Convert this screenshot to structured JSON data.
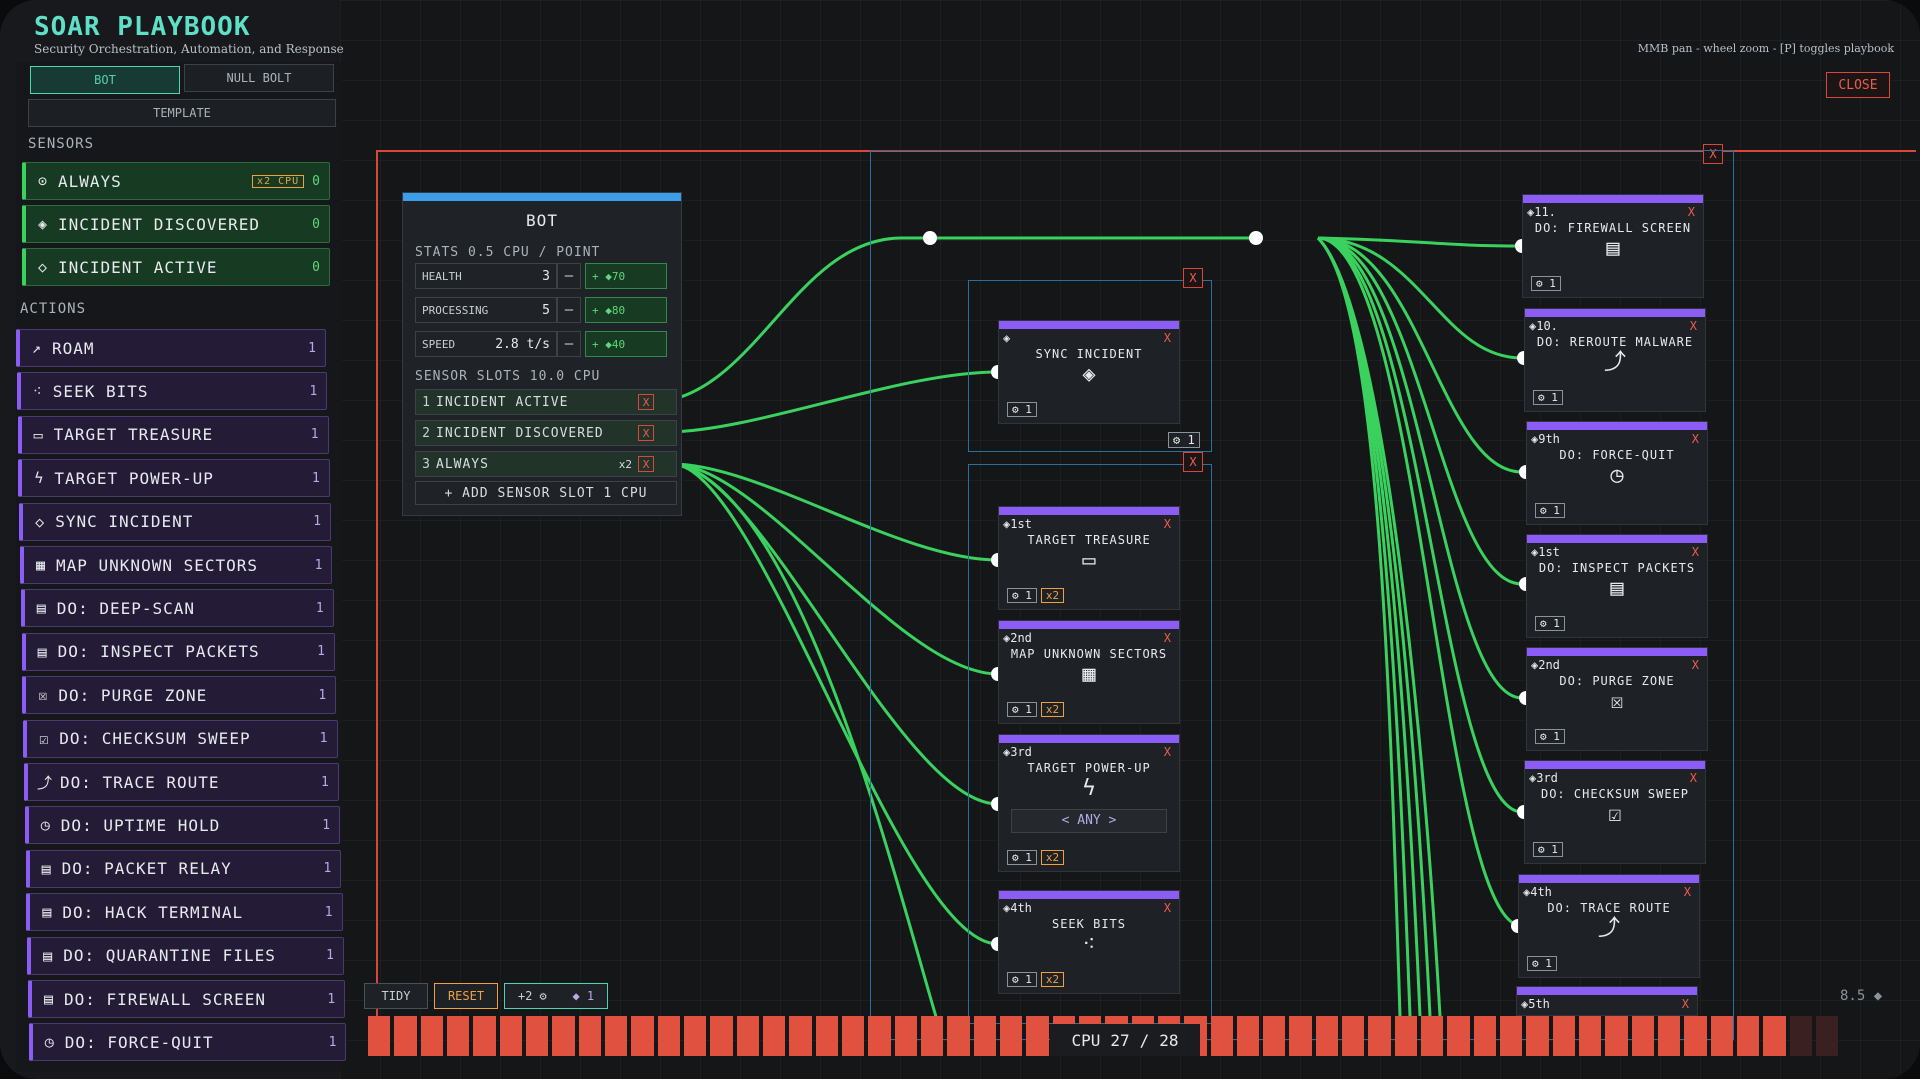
{
  "app": {
    "title": "SOAR PLAYBOOK",
    "subtitle": "Security Orchestration, Automation, and Response",
    "hint": "MMB pan - wheel zoom - [P] toggles playbook",
    "close_label": "CLOSE"
  },
  "tabs": {
    "bot": "BOT",
    "null_bolt": "NULL BOLT",
    "template": "TEMPLATE"
  },
  "sidebar": {
    "sensors_label": "SENSORS",
    "actions_label": "ACTIONS",
    "sensors": [
      {
        "label": "ALWAYS",
        "cost": "0",
        "badge": "x2 CPU",
        "icon": "clock-icon"
      },
      {
        "label": "INCIDENT DISCOVERED",
        "cost": "0",
        "icon": "diamond-dot-icon"
      },
      {
        "label": "INCIDENT ACTIVE",
        "cost": "0",
        "icon": "diamond-alert-icon"
      }
    ],
    "actions": [
      {
        "label": "ROAM",
        "cost": "1",
        "icon": "trend-icon"
      },
      {
        "label": "SEEK BITS",
        "cost": "1",
        "icon": "scatter-icon"
      },
      {
        "label": "TARGET TREASURE",
        "cost": "1",
        "icon": "chest-icon"
      },
      {
        "label": "TARGET POWER-UP",
        "cost": "1",
        "icon": "bolt-icon"
      },
      {
        "label": "SYNC INCIDENT",
        "cost": "1",
        "icon": "diamond-alert-icon"
      },
      {
        "label": "MAP UNKNOWN SECTORS",
        "cost": "1",
        "icon": "grid-icon"
      },
      {
        "label": "DO: DEEP-SCAN",
        "cost": "1",
        "icon": "clipboard-icon"
      },
      {
        "label": "DO: INSPECT PACKETS",
        "cost": "1",
        "icon": "clipboard-icon"
      },
      {
        "label": "DO: PURGE ZONE",
        "cost": "1",
        "icon": "clipboard-x-icon"
      },
      {
        "label": "DO: CHECKSUM SWEEP",
        "cost": "1",
        "icon": "clipboard-check-icon"
      },
      {
        "label": "DO: TRACE ROUTE",
        "cost": "1",
        "icon": "clipboard-route-icon"
      },
      {
        "label": "DO: UPTIME HOLD",
        "cost": "1",
        "icon": "clipboard-clock-icon"
      },
      {
        "label": "DO: PACKET RELAY",
        "cost": "1",
        "icon": "clipboard-icon"
      },
      {
        "label": "DO: HACK TERMINAL",
        "cost": "1",
        "icon": "clipboard-icon"
      },
      {
        "label": "DO: QUARANTINE FILES",
        "cost": "1",
        "icon": "clipboard-icon"
      },
      {
        "label": "DO: FIREWALL SCREEN",
        "cost": "1",
        "icon": "clipboard-icon"
      },
      {
        "label": "DO: FORCE-QUIT",
        "cost": "1",
        "icon": "clipboard-clock-icon"
      }
    ]
  },
  "bot": {
    "title": "BOT",
    "stats_line": "STATS  0.5 CPU / POINT",
    "stats": [
      {
        "name": "HEALTH",
        "value": "3",
        "bonus": "+ ◆70"
      },
      {
        "name": "PROCESSING",
        "value": "5",
        "bonus": "+ ◆80"
      },
      {
        "name": "SPEED",
        "value": "2.8 t/s",
        "bonus": "+ ◆40"
      }
    ],
    "slots_line": "SENSOR SLOTS  10.0 CPU",
    "slots": [
      {
        "n": "1",
        "label": "INCIDENT ACTIVE"
      },
      {
        "n": "2",
        "label": "INCIDENT DISCOVERED"
      },
      {
        "n": "3",
        "label": "ALWAYS",
        "badge": "x2"
      }
    ],
    "add_slot": "+ ADD SENSOR SLOT   1 CPU"
  },
  "middle_nodes": [
    {
      "rank": "",
      "title": "SYNC INCIDENT",
      "icon": "◈",
      "cost": "1"
    },
    {
      "rank": "1st",
      "title": "TARGET TREASURE",
      "icon": "▭",
      "cost": "1",
      "mult": "x2"
    },
    {
      "rank": "2nd",
      "title": "MAP UNKNOWN SECTORS",
      "icon": "▦",
      "cost": "1",
      "mult": "x2"
    },
    {
      "rank": "3rd",
      "title": "TARGET POWER-UP",
      "icon": "ϟ",
      "cost": "1",
      "mult": "x2",
      "selector": "< ANY >"
    },
    {
      "rank": "4th",
      "title": "SEEK BITS",
      "icon": "⁖",
      "cost": "1",
      "mult": "x2"
    }
  ],
  "group_cost": "1",
  "right_nodes": [
    {
      "rank": "11.",
      "title": "DO: FIREWALL SCREEN",
      "icon": "▤",
      "cost": "1"
    },
    {
      "rank": "10.",
      "title": "DO: REROUTE MALWARE",
      "icon": "⤴",
      "cost": "1"
    },
    {
      "rank": "9th",
      "title": "DO: FORCE-QUIT",
      "icon": "◷",
      "cost": "1"
    },
    {
      "rank": "1st",
      "title": "DO: INSPECT PACKETS",
      "icon": "▤",
      "cost": "1"
    },
    {
      "rank": "2nd",
      "title": "DO: PURGE ZONE",
      "icon": "☒",
      "cost": "1"
    },
    {
      "rank": "3rd",
      "title": "DO: CHECKSUM SWEEP",
      "icon": "☑",
      "cost": "1"
    },
    {
      "rank": "4th",
      "title": "DO: TRACE ROUTE",
      "icon": "⤴",
      "cost": "1"
    },
    {
      "rank": "5th",
      "title": "",
      "icon": "",
      "cost": ""
    }
  ],
  "controls": {
    "tidy": "TIDY",
    "reset": "RESET",
    "plus": "+2 ⚙",
    "count": "◆ 1"
  },
  "cpu": {
    "label": "CPU",
    "used": "27",
    "sep": "/",
    "total": "28",
    "fill": 0.964
  },
  "zoom": "8.5 ◆",
  "colors": {
    "accent": "#4fd3b4",
    "wire": "#3ad15e",
    "danger": "#e0513f",
    "action": "#8b5cf6"
  }
}
